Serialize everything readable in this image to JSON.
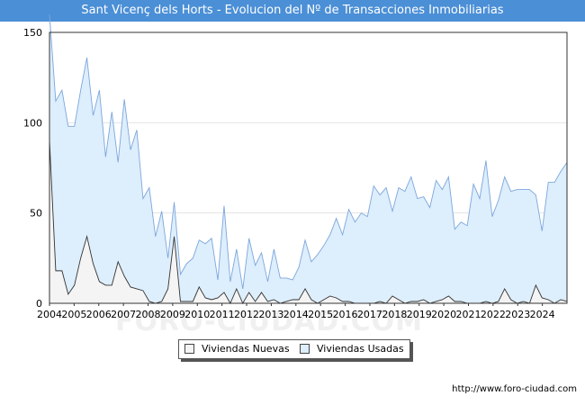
{
  "chart_data": {
    "type": "area",
    "title": "Sant Vicenç dels Horts - Evolucion del Nº de Transacciones Inmobiliarias",
    "xlabel": "",
    "ylabel": "",
    "ylim": [
      0,
      150
    ],
    "yticks": [
      0,
      50,
      100,
      150
    ],
    "xticks": [
      "2004",
      "2005",
      "2006",
      "2007",
      "2008",
      "2009",
      "2010",
      "2011",
      "2012",
      "2013",
      "2014",
      "2015",
      "2016",
      "2017",
      "2018",
      "2019",
      "2020",
      "2021",
      "2022",
      "2023",
      "2024"
    ],
    "grid": true,
    "legend_position": "bottom-center",
    "x": [
      "2004 T1",
      "2004 T2",
      "2004 T3",
      "2004 T4",
      "2005 T1",
      "2005 T2",
      "2005 T3",
      "2005 T4",
      "2006 T1",
      "2006 T2",
      "2006 T3",
      "2006 T4",
      "2007 T1",
      "2007 T2",
      "2007 T3",
      "2007 T4",
      "2008 T1",
      "2008 T2",
      "2008 T3",
      "2008 T4",
      "2009 T1",
      "2009 T2",
      "2009 T3",
      "2009 T4",
      "2010 T1",
      "2010 T2",
      "2010 T3",
      "2010 T4",
      "2011 T1",
      "2011 T2",
      "2011 T3",
      "2011 T4",
      "2012 T1",
      "2012 T2",
      "2012 T3",
      "2012 T4",
      "2013 T1",
      "2013 T2",
      "2013 T3",
      "2013 T4",
      "2014 T1",
      "2014 T2",
      "2014 T3",
      "2014 T4",
      "2015 T1",
      "2015 T2",
      "2015 T3",
      "2015 T4",
      "2016 T1",
      "2016 T2",
      "2016 T3",
      "2016 T4",
      "2017 T1",
      "2017 T2",
      "2017 T3",
      "2017 T4",
      "2018 T1",
      "2018 T2",
      "2018 T3",
      "2018 T4",
      "2019 T1",
      "2019 T2",
      "2019 T3",
      "2019 T4",
      "2020 T1",
      "2020 T2",
      "2020 T3",
      "2020 T4",
      "2021 T1",
      "2021 T2",
      "2021 T3",
      "2021 T4",
      "2022 T1",
      "2022 T2",
      "2022 T3",
      "2022 T4",
      "2023 T1",
      "2023 T2",
      "2023 T3",
      "2023 T4",
      "2024 T1",
      "2024 T2",
      "2024 T3",
      "2024 T4"
    ],
    "series": [
      {
        "name": "Viviendas Usadas",
        "color": "#7ca6dc",
        "fill": "#ddeefc",
        "values": [
          160,
          112,
          118,
          98,
          98,
          118,
          136,
          104,
          118,
          81,
          106,
          78,
          113,
          85,
          96,
          58,
          64,
          37,
          51,
          25,
          56,
          16,
          22,
          25,
          35,
          33,
          36,
          13,
          54,
          12,
          30,
          8,
          36,
          21,
          28,
          12,
          30,
          14,
          14,
          13,
          20,
          35,
          23,
          27,
          32,
          38,
          47,
          38,
          52,
          45,
          50,
          48,
          65,
          60,
          64,
          51,
          64,
          62,
          70,
          58,
          59,
          53,
          68,
          63,
          70,
          41,
          45,
          43,
          66,
          58,
          79,
          48,
          57,
          70,
          62,
          63,
          63,
          63,
          60,
          40,
          67,
          67,
          73,
          78
        ]
      },
      {
        "name": "Viviendas Nuevas",
        "color": "#333333",
        "fill": "#f4f4f4",
        "values": [
          90,
          18,
          18,
          5,
          10,
          25,
          37,
          22,
          12,
          10,
          10,
          23,
          15,
          9,
          8,
          7,
          1,
          0,
          1,
          8,
          37,
          1,
          1,
          1,
          9,
          3,
          2,
          3,
          6,
          0,
          8,
          0,
          6,
          1,
          6,
          1,
          2,
          0,
          1,
          2,
          2,
          8,
          2,
          0,
          2,
          4,
          3,
          1,
          1,
          0,
          0,
          0,
          0,
          1,
          0,
          4,
          2,
          0,
          1,
          1,
          2,
          0,
          1,
          2,
          4,
          1,
          1,
          0,
          0,
          0,
          1,
          0,
          1,
          8,
          2,
          0,
          1,
          0,
          10,
          3,
          2,
          0,
          2,
          1
        ]
      }
    ]
  },
  "legend": {
    "nuevas_label": "Viviendas Nuevas",
    "usadas_label": "Viviendas Usadas"
  },
  "watermark": "FORO-CIUDAD.COM",
  "url": "http://www.foro-ciudad.com"
}
